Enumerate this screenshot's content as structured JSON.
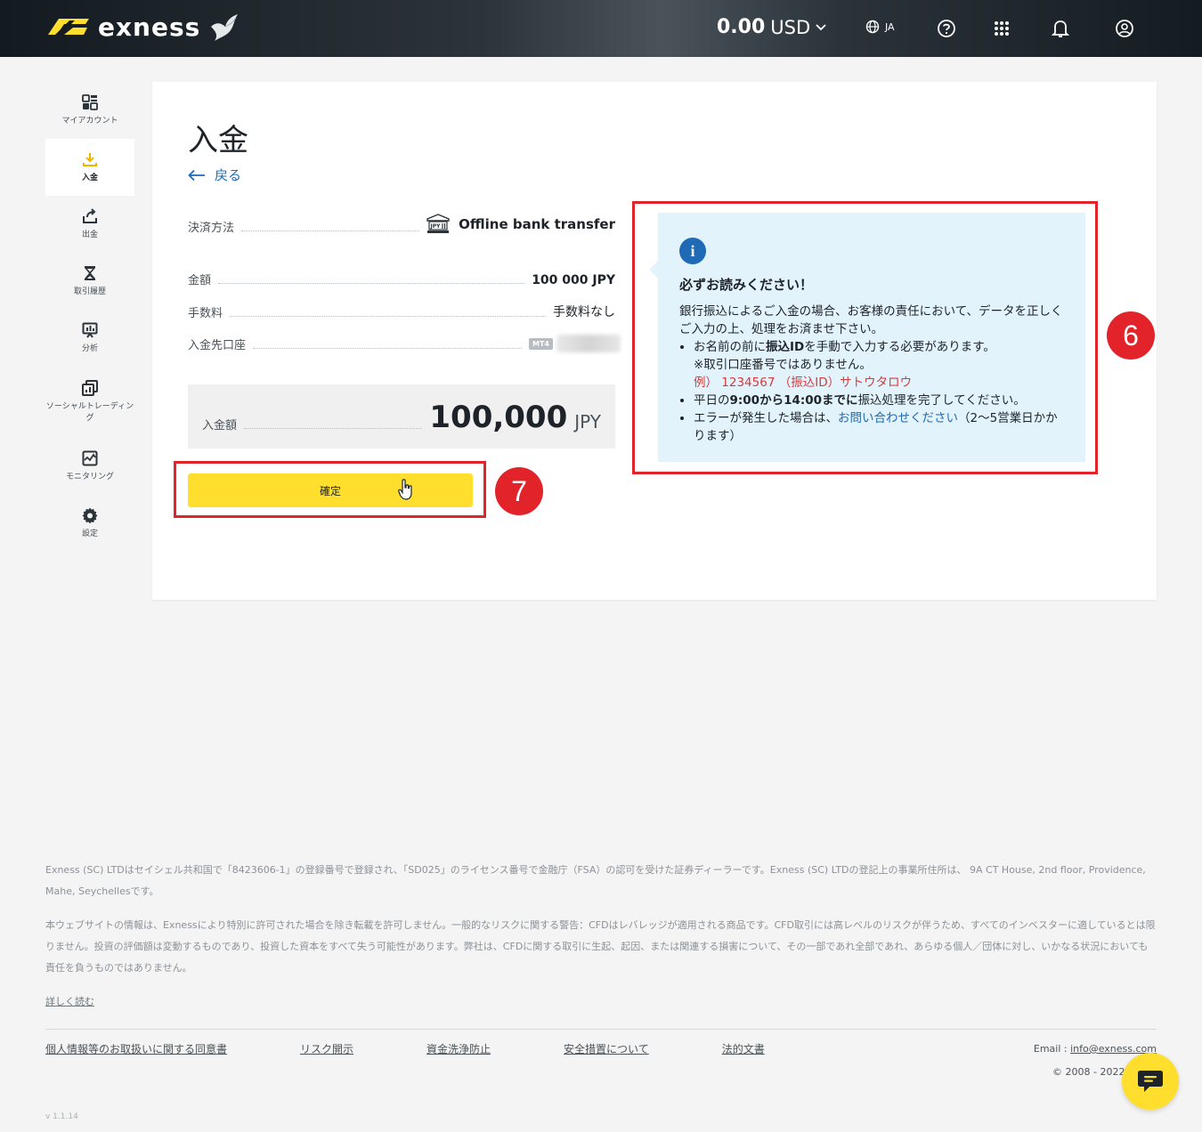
{
  "header": {
    "brand": "exness",
    "balance_amount": "0.00",
    "balance_currency": "USD",
    "language": "JA",
    "icons": [
      "help-icon",
      "apps-grid-icon",
      "bell-icon",
      "user-profile-icon"
    ]
  },
  "sidebar": {
    "items": [
      {
        "label": "マイアカウント",
        "icon": "dashboard-icon",
        "active": false
      },
      {
        "label": "入金",
        "icon": "deposit-icon",
        "active": true
      },
      {
        "label": "出金",
        "icon": "withdraw-icon",
        "active": false
      },
      {
        "label": "取引履歴",
        "icon": "hourglass-icon",
        "active": false
      },
      {
        "label": "分析",
        "icon": "analytics-icon",
        "active": false
      },
      {
        "label": "ソーシャルトレーディング",
        "icon": "social-trading-icon",
        "active": false
      },
      {
        "label": "モニタリング",
        "icon": "monitoring-icon",
        "active": false
      },
      {
        "label": "設定",
        "icon": "gear-icon",
        "active": false
      }
    ]
  },
  "main": {
    "title": "入金",
    "back_label": "戻る",
    "payment_method_label": "決済方法",
    "payment_method_value": "Offline bank transfer",
    "amount_label": "金額",
    "amount_value": "100 000 JPY",
    "fee_label": "手数料",
    "fee_value": "手数料なし",
    "account_label": "入金先口座",
    "account_badge": "MT4",
    "total_label": "入金額",
    "total_value": "100,000",
    "total_currency": "JPY",
    "confirm_label": "確定"
  },
  "notice": {
    "heading": "必ずお読みください！",
    "intro": "銀行振込によるご入金の場合、お客様の責任において、データを正しくご入力の上、処理をお済ませ下さい。",
    "bullet1_pre": "お名前の前に",
    "bullet1_bold": "振込ID",
    "bullet1_post": "を手動で入力する必要があります。",
    "bullet1_note": "※取引口座番号ではありません。",
    "bullet1_example": "例） 1234567 （振込ID）サトウタロウ",
    "bullet2_pre": "平日の",
    "bullet2_bold": "9:00から14:00までに",
    "bullet2_post": "振込処理を完了してください。",
    "bullet3_pre": "エラーが発生した場合は、",
    "bullet3_link": "お問い合わせください",
    "bullet3_post": "（2〜5営業日かかります）"
  },
  "annotations": {
    "badge_6": "6",
    "badge_7": "7",
    "color": "#e3232a"
  },
  "footer": {
    "legal1": "Exness (SC) LTDはセイシェル共和国で「8423606-1」の登録番号で登録され、「SD025」のライセンス番号で金融庁（FSA）の認可を受けた証券ディーラーです。Exness (SC) LTDの登記上の事業所住所は、 9A CT House, 2nd floor, Providence, Mahe, Seychellesです。",
    "legal2": "本ウェブサイトの情報は、Exnessにより特別に許可された場合を除き転載を許可しません。一般的なリスクに関する警告：CFDはレバレッジが適用される商品です。CFD取引には高レベルのリスクが伴うため、すべてのインベスターに適しているとは限りません。投資の評価額は変動するものであり、投資した資本をすべて失う可能性があります。弊社は、CFDに関する取引に生起、起因、または関連する損害について、その一部であれ全部であれ、あらゆる個人／団体に対し、いかなる状況においても責任を負うものではありません。",
    "read_more": "詳しく読む",
    "links": [
      "個人情報等のお取扱いに関する同意書",
      "リスク開示",
      "資金洗浄防止",
      "安全措置について",
      "法的文書"
    ],
    "email_label": "Email : ",
    "email": "info@exness.com",
    "copyright": "© 2008 - 2022.",
    "version": "v 1.1.14"
  },
  "colors": {
    "accent_yellow": "#ffde2d",
    "link_blue": "#1e6ab5",
    "info_bg": "#e3f3fc",
    "annotation_red": "#e3232a"
  }
}
